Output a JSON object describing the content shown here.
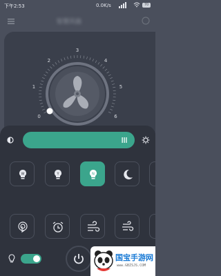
{
  "status": {
    "time": "下午2:53",
    "speed": "0.0K/s",
    "battery": "70"
  },
  "appbar": {
    "title": "智慧风扇"
  },
  "dial": {
    "ticks": [
      "0",
      "1",
      "2",
      "3",
      "4",
      "5",
      "6"
    ],
    "speed_level": 0
  },
  "brightness": {
    "level_fraction": 1.0
  },
  "modes_row1": [
    "bulb-w-icon",
    "bulb-y-icon",
    "bulb-n-icon",
    "moon-icon"
  ],
  "modes_row2": [
    "touch-icon",
    "alarm-clock-icon",
    "wind-icon",
    "wind-alt-icon"
  ],
  "light_toggle_on": true,
  "watermark": {
    "brand": "国宝手游网",
    "url": "www.GBZSJS.COM"
  }
}
